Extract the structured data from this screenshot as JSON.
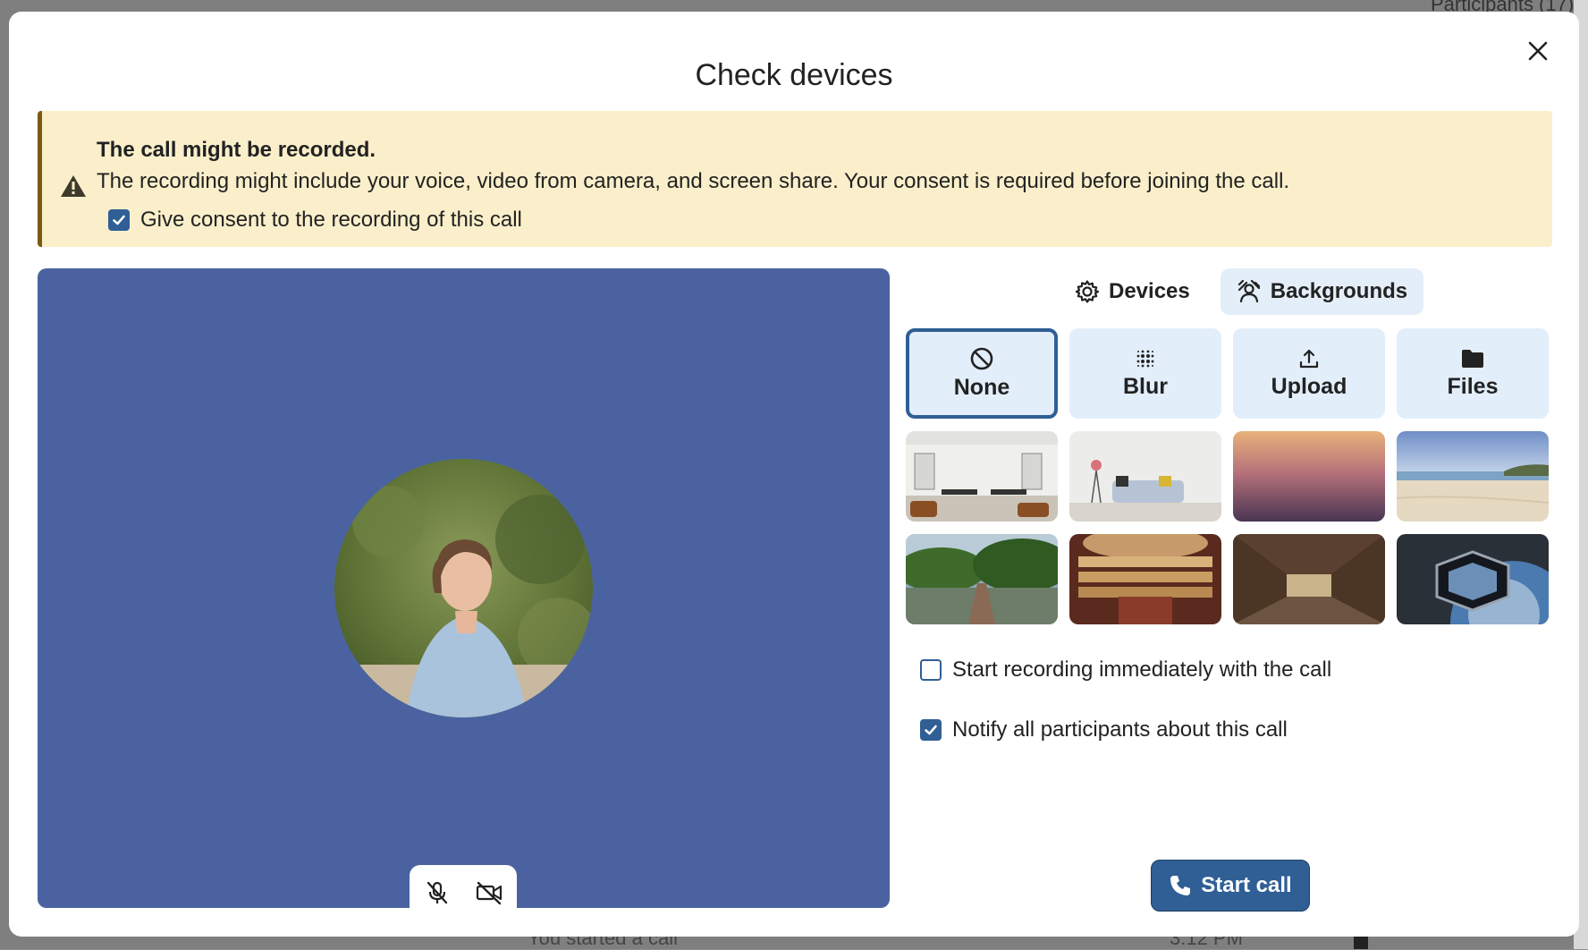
{
  "background_app": {
    "top_right_text": "Participants (17)",
    "bottom_message": "You started a call",
    "bottom_time": "3:12 PM"
  },
  "modal": {
    "title": "Check devices"
  },
  "warning": {
    "title": "The call might be recorded.",
    "text": "The recording might include your voice, video from camera, and screen share. Your consent is required before joining the call.",
    "consent_label": "Give consent to the recording of this call",
    "consent_checked": true
  },
  "tabs": [
    {
      "label": "Devices",
      "icon": "gear-icon",
      "active": false
    },
    {
      "label": "Backgrounds",
      "icon": "person-background-icon",
      "active": true
    }
  ],
  "background_options": [
    {
      "label": "None",
      "icon": "none-icon",
      "selected": true
    },
    {
      "label": "Blur",
      "icon": "blur-icon",
      "selected": false
    },
    {
      "label": "Upload",
      "icon": "upload-icon",
      "selected": false
    },
    {
      "label": "Files",
      "icon": "folder-icon",
      "selected": false
    }
  ],
  "background_images": [
    "office-background",
    "living-room-background",
    "sunset-gradient-background",
    "beach-background",
    "jungle-bridge-background",
    "theater-background",
    "library-background",
    "space-station-background"
  ],
  "options": {
    "start_recording_label": "Start recording immediately with the call",
    "start_recording_checked": false,
    "notify_label": "Notify all participants about this call",
    "notify_checked": true
  },
  "start_call_label": "Start call",
  "colors": {
    "primary": "#2f5f95",
    "preview_bg": "#4a63a0",
    "warning_bg": "#faefca",
    "option_bg": "#e2eefa"
  }
}
